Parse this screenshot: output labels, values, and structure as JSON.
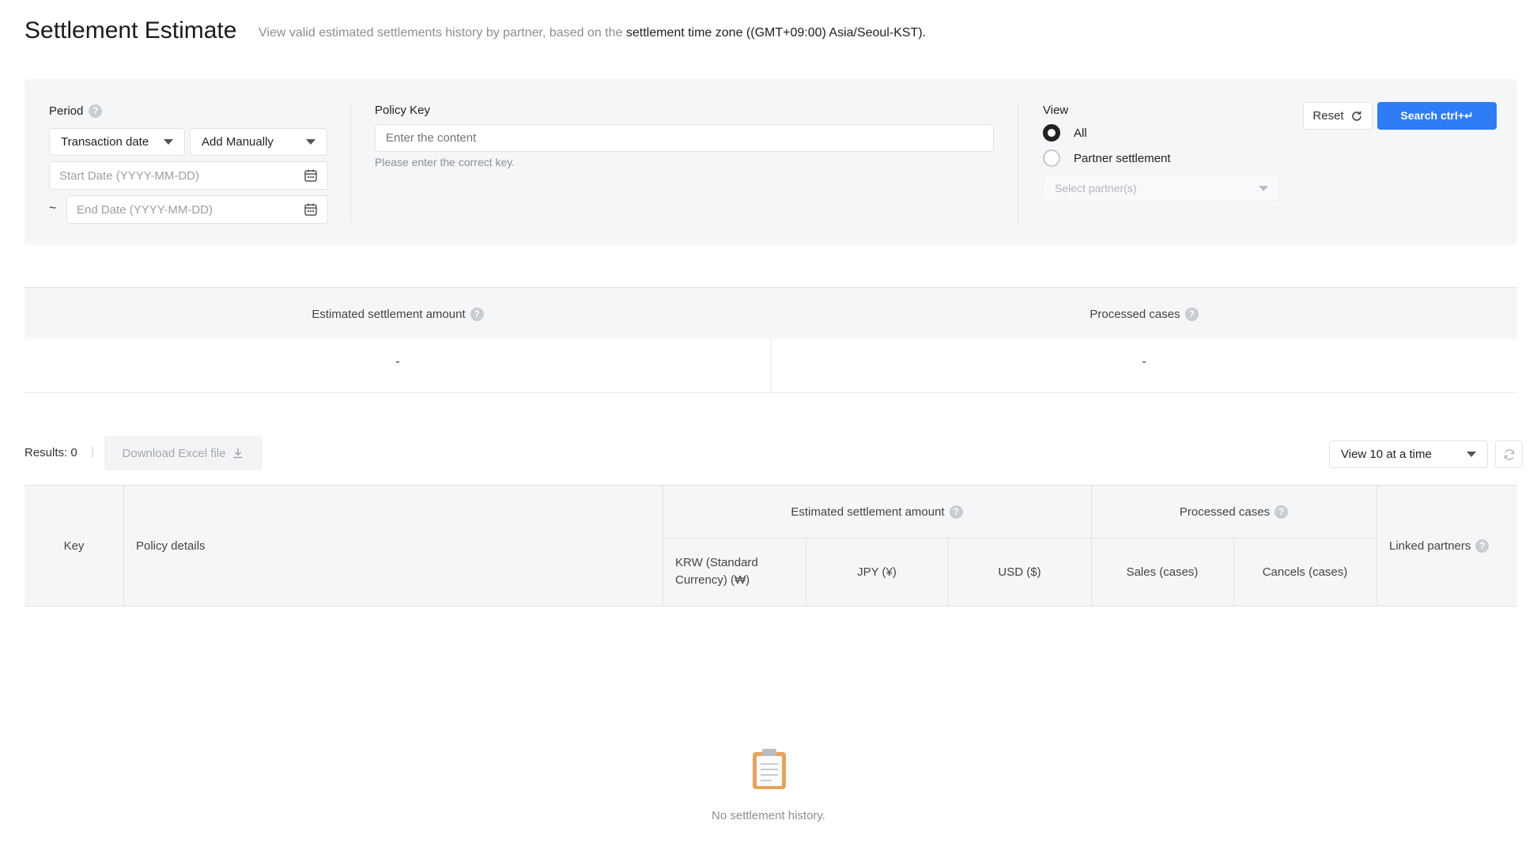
{
  "header": {
    "title": "Settlement Estimate",
    "description_prefix": "View valid estimated settlements history by partner, based on the ",
    "description_highlight": "settlement time zone ((GMT+09:00) Asia/Seoul-KST)."
  },
  "filters": {
    "period": {
      "label": "Period",
      "date_type_value": "Transaction date",
      "range_mode_value": "Add Manually",
      "start_placeholder": "Start Date (YYYY-MM-DD)",
      "end_placeholder": "End Date (YYYY-MM-DD)",
      "range_separator": "~"
    },
    "policy_key": {
      "label": "Policy Key",
      "placeholder": "Enter the content",
      "hint": "Please enter the correct key."
    },
    "view": {
      "label": "View",
      "options": [
        {
          "label": "All",
          "selected": true
        },
        {
          "label": "Partner settlement",
          "selected": false
        }
      ],
      "partner_placeholder": "Select partner(s)"
    },
    "reset_label": "Reset",
    "search_label": "Search ctrl+↵"
  },
  "summary": {
    "columns": [
      {
        "label": "Estimated settlement amount",
        "value": "-"
      },
      {
        "label": "Processed cases",
        "value": "-"
      }
    ]
  },
  "results_bar": {
    "results_label": "Results: 0",
    "separator": "|",
    "download_label": "Download Excel file",
    "page_size_value": "View 10 at a time"
  },
  "table": {
    "headers": {
      "key": "Key",
      "policy_details": "Policy details",
      "estimated_group": "Estimated settlement amount",
      "krw": "KRW (Standard Currency) (₩)",
      "jpy": "JPY (¥)",
      "usd": "USD ($)",
      "processed_group": "Processed cases",
      "sales": "Sales (cases)",
      "cancels": "Cancels (cases)",
      "linked_partners": "Linked partners"
    },
    "rows": []
  },
  "empty_state": {
    "icon": "clipboard-icon",
    "message": "No settlement history."
  },
  "colors": {
    "primary": "#2f7cf6",
    "panel_bg": "#f5f6f8",
    "empty_icon": "#e8a35c"
  }
}
